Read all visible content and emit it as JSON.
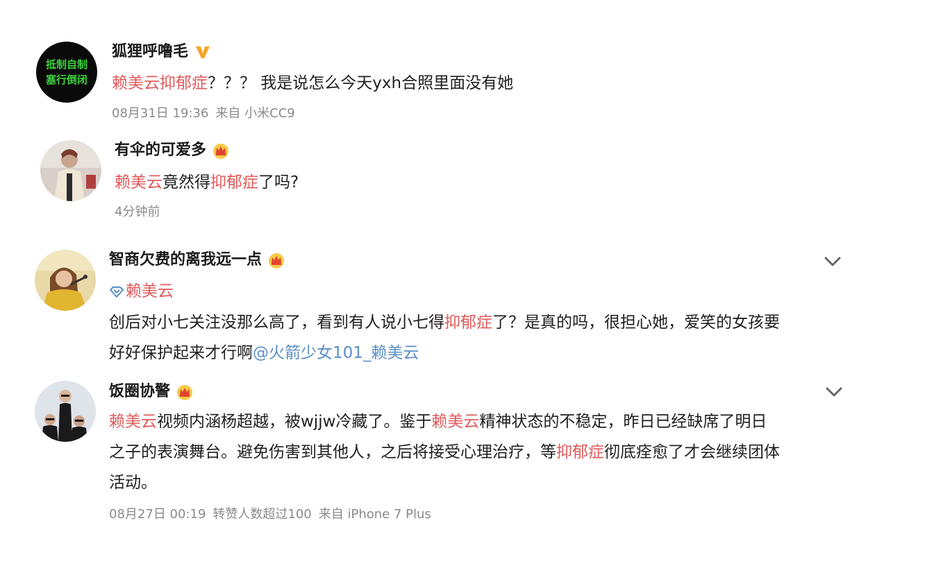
{
  "posts": [
    {
      "username": "狐狸呼噜毛",
      "badge": "verified-v-icon",
      "avatar_text_line1": "抵制自制",
      "avatar_text_line2": "塞行倒闭",
      "content": [
        {
          "text": "赖美云抑郁症",
          "style": "hl"
        },
        {
          "text": "？？？ 我是说怎么今天yxh合照里面没有她",
          "style": ""
        }
      ],
      "time": "08月31日 19:36",
      "source": "来自 小米CC9"
    },
    {
      "username": "有伞的可爱多",
      "badge": "crown-icon",
      "content": [
        {
          "text": "赖美云",
          "style": "hl"
        },
        {
          "text": "竟然得",
          "style": ""
        },
        {
          "text": "抑郁症",
          "style": "hl"
        },
        {
          "text": "了吗?",
          "style": ""
        }
      ],
      "time": "4分钟前"
    },
    {
      "username": "智商欠费的离我远一点",
      "badge": "crown-icon",
      "topic": "赖美云",
      "content_lines": [
        [
          {
            "text": "创后对小七关注没那么高了，看到有人说小七得",
            "style": ""
          },
          {
            "text": "抑郁症",
            "style": "hl"
          },
          {
            "text": "了？是真的吗，很担心她，爱笑的女孩要",
            "style": ""
          }
        ],
        [
          {
            "text": "好好保护起来才行啊",
            "style": ""
          },
          {
            "text": "@火箭少女101_赖美云",
            "style": "at"
          }
        ]
      ]
    },
    {
      "username": "饭圈协警",
      "badge": "crown-icon",
      "content_lines": [
        [
          {
            "text": "赖美云",
            "style": "hl"
          },
          {
            "text": "视频内涵杨超越，被wjjw冷藏了。鉴于",
            "style": ""
          },
          {
            "text": "赖美云",
            "style": "hl"
          },
          {
            "text": "精神状态的不稳定，昨日已经缺席了明日",
            "style": ""
          }
        ],
        [
          {
            "text": "之子的表演舞台。避免伤害到其他人，之后将接受心理治疗，等",
            "style": ""
          },
          {
            "text": "抑郁症",
            "style": "hl"
          },
          {
            "text": "彻底痊愈了才会继续团体",
            "style": ""
          }
        ],
        [
          {
            "text": "活动。",
            "style": ""
          }
        ]
      ],
      "time": "08月27日 00:19",
      "reposts": "转赞人数超过100",
      "source": "来自 iPhone 7 Plus"
    }
  ],
  "colors": {
    "highlight": "#e05a5a",
    "mention": "#5a8fc7",
    "meta": "#8a8a8a",
    "verified": "#f5a623",
    "crown": "#f0a830"
  }
}
